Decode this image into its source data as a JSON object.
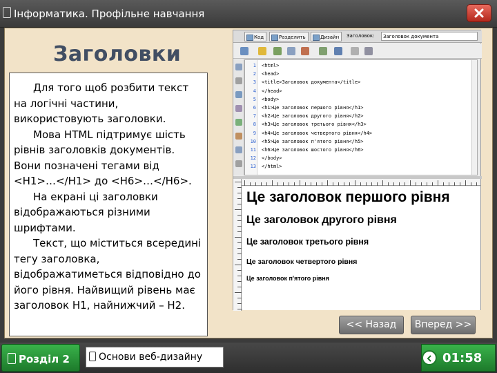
{
  "window": {
    "title": "Інформатика. Профільне навчання",
    "title_icon": "document-icon",
    "close_icon": "close-icon"
  },
  "slide": {
    "heading": "Заголовки",
    "paragraphs": [
      {
        "text": "Для того щоб розбити текст на логічні частини, використовують заголовки.",
        "first_line_indent": true
      },
      {
        "text": "Мова HTML підтримує шість рівнів заголовків документів. Вони позначені тегами від <H1>…</H1> до <H6>…</H6>.",
        "first_line_indent": true
      },
      {
        "text": "На екрані ці заголовки відображаються різними шрифтами.",
        "first_line_indent": true
      },
      {
        "text": " Текст, що міститься всередині тегу заголовка, відображатиметься відповідно до його рівня. Найвищий рівень має заголовок H1, найнижчий – H2.",
        "first_line_indent": true
      }
    ]
  },
  "editor": {
    "tabs": [
      "Код",
      "Разделить",
      "Дизайн"
    ],
    "title_label": "Заголовок:",
    "title_value": "Заголовок документа",
    "code_lines": [
      {
        "n": "1",
        "src": "<html>"
      },
      {
        "n": "2",
        "src": "<head>"
      },
      {
        "n": "3",
        "src": "<title>Заголовок документа</title>"
      },
      {
        "n": "4",
        "src": "</head>"
      },
      {
        "n": "5",
        "src": "<body>"
      },
      {
        "n": "6",
        "src": "<h1>Це заголовок першого рівня</h1>"
      },
      {
        "n": "7",
        "src": "<h2>Це заголовок другого рівня</h2>"
      },
      {
        "n": "8",
        "src": "<h3>Це заголовок третього рівня</h3>"
      },
      {
        "n": "9",
        "src": "<h4>Це заголовок четвертого рівня</h4>"
      },
      {
        "n": "10",
        "src": "<h5>Це заголовок п'ятого рівня</h5>"
      },
      {
        "n": "11",
        "src": "<h6>Це заголовок шостого рівня</h6>"
      },
      {
        "n": "12",
        "src": "</body>"
      },
      {
        "n": "13",
        "src": "</html>"
      }
    ],
    "preview": [
      "Це заголовок першого рівня",
      "Це заголовок другого рівня",
      "Це заголовок третього рівня",
      "Це заголовок четвертого рівня",
      "Це заголовок п'ятого рівня"
    ]
  },
  "nav": {
    "back_label": "<< Назад",
    "forward_label": "Вперед >>"
  },
  "footer": {
    "section_label": "Розділ 2",
    "section_icon": "document-icon",
    "topic_label": "Основи веб-дизайну",
    "topic_icon": "document-icon",
    "timer": "01:58",
    "timer_icon": "clock-icon"
  },
  "colors": {
    "stage_bg": "#f2e3c8",
    "heading": "#414e63",
    "accent_green": "#2a9a3a",
    "close_red": "#c8392b"
  }
}
